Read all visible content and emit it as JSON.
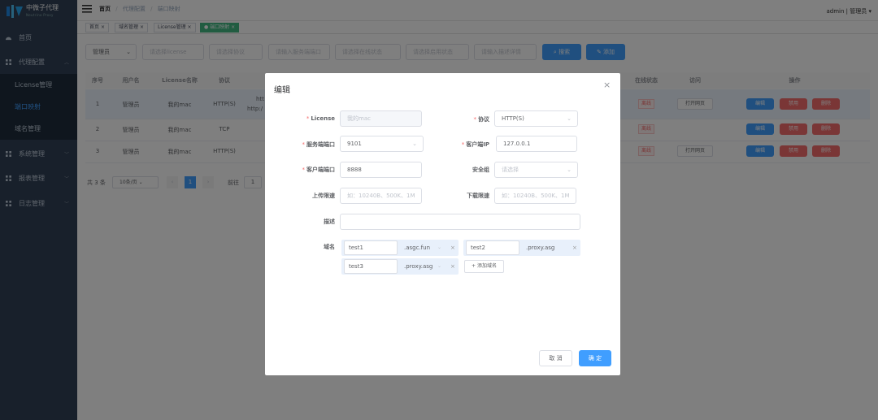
{
  "colors": {
    "sidebar_bg": "#304156",
    "primary": "#409eff",
    "danger": "#f56c6c",
    "tag_active": "#42b983"
  },
  "app": {
    "logo_text": "中微子代理",
    "logo_sub": "Neutrino Proxy"
  },
  "sidebar": {
    "items": [
      {
        "label": "首页",
        "icon": "dashboard-icon"
      },
      {
        "label": "代理配置",
        "icon": "grid-icon"
      },
      {
        "label": "系统管理",
        "icon": "grid-icon"
      },
      {
        "label": "报表管理",
        "icon": "grid-icon"
      },
      {
        "label": "日志管理",
        "icon": "grid-icon"
      }
    ],
    "subitems": [
      {
        "label": "License管理"
      },
      {
        "label": "端口映射"
      },
      {
        "label": "域名管理"
      }
    ]
  },
  "header": {
    "breadcrumb": [
      "首页",
      "代理配置",
      "端口映射"
    ],
    "user": "admin | 管理员"
  },
  "tags": [
    {
      "label": "首页"
    },
    {
      "label": "域名管理"
    },
    {
      "label": "License管理"
    },
    {
      "label": "端口映射"
    }
  ],
  "filters": {
    "user": "管理员",
    "license_ph": "请选择license",
    "protocol_ph": "请选择协议",
    "port_ph": "请输入服务端端口",
    "online_ph": "请选择在线状态",
    "enable_ph": "请选择启用状态",
    "desc_ph": "请输入描述详情",
    "search": "搜索",
    "add": "添加"
  },
  "table": {
    "headers": [
      "序号",
      "用户名",
      "License名称",
      "协议",
      "在线状态",
      "访问",
      "操作"
    ],
    "rows": [
      {
        "idx": "1",
        "user": "管理员",
        "license": "我的mac",
        "protocol": "HTTP(S)",
        "extra": "htt",
        "extra2": "http:/",
        "status": "离线",
        "visit": "打开网页"
      },
      {
        "idx": "2",
        "user": "管理员",
        "license": "我的mac",
        "protocol": "TCP",
        "extra": "",
        "extra2": "",
        "status": "离线",
        "visit": ""
      },
      {
        "idx": "3",
        "user": "管理员",
        "license": "我的mac",
        "protocol": "HTTP(S)",
        "extra": "",
        "extra2": "",
        "status": "离线",
        "visit": "打开网页"
      }
    ],
    "actions": {
      "edit": "编辑",
      "disable": "禁用",
      "delete": "删除"
    }
  },
  "pagination": {
    "total": "共 3 条",
    "page_size": "10条/页",
    "prev": "‹",
    "page": "1",
    "next": "›",
    "goto": "前往",
    "goto_val": "1"
  },
  "dialog": {
    "title": "编辑",
    "close": "×",
    "license_label": "License",
    "license_value": "我的mac",
    "protocol_label": "协议",
    "protocol_value": "HTTP(S)",
    "server_port_label": "服务端端口",
    "server_port_value": "9101",
    "client_ip_label": "客户端IP",
    "client_ip_value": "127.0.0.1",
    "client_port_label": "客户端端口",
    "client_port_value": "8888",
    "security_label": "安全组",
    "security_ph": "请选择",
    "upload_label": "上传限速",
    "upload_ph": "如：10240B、500K、1M",
    "download_label": "下载限速",
    "download_ph": "如：10240B、500K、1M",
    "desc_label": "描述",
    "domain_label": "域名",
    "domains": [
      {
        "name": "test1",
        "suffix": ".asgc.fun"
      },
      {
        "name": "test2",
        "suffix": ".proxy.asg"
      },
      {
        "name": "test3",
        "suffix": ".proxy.asg"
      }
    ],
    "add_domain": "+ 添加域名",
    "cancel": "取 消",
    "confirm": "确 定"
  }
}
